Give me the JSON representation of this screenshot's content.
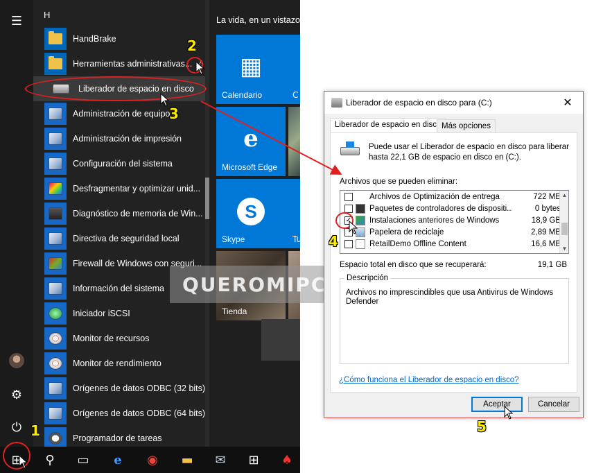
{
  "start_menu": {
    "section_letter": "H",
    "apps": [
      {
        "label": "HandBrake",
        "icon": "folder-icon"
      },
      {
        "label": "Herramientas administrativas...",
        "icon": "folder-icon",
        "expand_glyph": "˄"
      },
      {
        "label": "Liberador de espacio en disco",
        "icon": "disk-cleanup-icon"
      },
      {
        "label": "Administración de equipo",
        "icon": "computer-management-icon"
      },
      {
        "label": "Administración de impresión",
        "icon": "print-management-icon"
      },
      {
        "label": "Configuración del sistema",
        "icon": "system-config-icon"
      },
      {
        "label": "Desfragmentar y optimizar unid...",
        "icon": "defrag-icon"
      },
      {
        "label": "Diagnóstico de memoria de Win...",
        "icon": "memory-diagnostic-icon"
      },
      {
        "label": "Directiva de seguridad local",
        "icon": "security-policy-icon"
      },
      {
        "label": "Firewall de Windows con seguri...",
        "icon": "firewall-icon"
      },
      {
        "label": "Información del sistema",
        "icon": "system-info-icon"
      },
      {
        "label": "Iniciador iSCSI",
        "icon": "iscsi-icon"
      },
      {
        "label": "Monitor de recursos",
        "icon": "resource-monitor-icon"
      },
      {
        "label": "Monitor de rendimiento",
        "icon": "performance-monitor-icon"
      },
      {
        "label": "Orígenes de datos ODBC (32 bits)",
        "icon": "odbc-icon"
      },
      {
        "label": "Orígenes de datos ODBC (64 bits)",
        "icon": "odbc-icon"
      },
      {
        "label": "Programador de tareas",
        "icon": "task-scheduler-icon"
      }
    ],
    "rail": {
      "menu_glyph": "☰",
      "settings_glyph": "⚙",
      "power_glyph": "⏻"
    }
  },
  "tiles": {
    "group_title": "La vida, en un vistazo",
    "items": [
      {
        "label": "Calendario",
        "glyph": "▦"
      },
      {
        "label": "Microsoft Edge",
        "glyph": "e"
      },
      {
        "label": "Skype",
        "glyph": "S"
      },
      {
        "label": "Tienda",
        "glyph": ""
      }
    ],
    "partial_labels": [
      "C",
      "Tu"
    ]
  },
  "taskbar": {
    "start_glyph": "⊞",
    "search_glyph": "⚲",
    "task_view_glyph": "▭",
    "edge_glyph": "e",
    "chrome_glyph": "◉",
    "explorer_glyph": "▬",
    "mail_glyph": "✉",
    "store_glyph": "⊞",
    "solitaire_glyph": "♠"
  },
  "watermark": {
    "text": "QUEROMIPC.com"
  },
  "dialog": {
    "title": "Liberador de espacio en disco para  (C:)",
    "close_glyph": "✕",
    "tabs": [
      "Liberador de espacio en disco",
      "Más opciones"
    ],
    "intro": "Puede usar el Liberador de espacio en disco para liberar hasta 22,1 GB de espacio en disco en  (C:).",
    "files_label": "Archivos que se pueden eliminar:",
    "files": [
      {
        "name": "Archivos de Optimización de entrega",
        "size": "722 MB",
        "checked": false
      },
      {
        "name": "Paquetes de controladores de dispositi...",
        "size": "0 bytes",
        "checked": false
      },
      {
        "name": "Instalaciones anteriores de Windows",
        "size": "18,9 GB",
        "checked": true
      },
      {
        "name": "Papelera de reciclaje",
        "size": "2,89 MB",
        "checked": false
      },
      {
        "name": "RetailDemo Offline Content",
        "size": "16,6 MB",
        "checked": false
      }
    ],
    "total_label": "Espacio total en disco que se recuperará:",
    "total_value": "19,1 GB",
    "description_legend": "Descripción",
    "description_text": "Archivos no imprescindibles que usa Antivirus de Windows Defender",
    "help_link": "¿Cómo funciona el Liberador de espacio en disco?",
    "ok_button": "Aceptar",
    "cancel_button": "Cancelar"
  },
  "annotations": {
    "step1": "1",
    "step2": "2",
    "step3": "3",
    "step4": "4",
    "step5": "5"
  },
  "colors": {
    "accent": "#0078d7",
    "annotation_red": "#e02020",
    "annotation_yellow": "#ffeb00"
  }
}
